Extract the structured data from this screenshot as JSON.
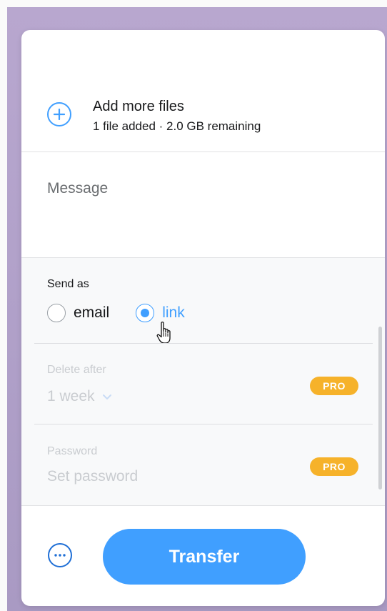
{
  "upload": {
    "add_title": "Add more files",
    "add_subtitle": "1 file added · 2.0 GB remaining"
  },
  "message": {
    "placeholder": "Message"
  },
  "send_as": {
    "label": "Send as",
    "options": [
      {
        "label": "email",
        "selected": false
      },
      {
        "label": "link",
        "selected": true
      }
    ]
  },
  "delete_after": {
    "label": "Delete after",
    "value": "1 week",
    "badge": "PRO"
  },
  "password": {
    "label": "Password",
    "placeholder": "Set password",
    "badge": "PRO"
  },
  "actions": {
    "transfer_label": "Transfer"
  },
  "colors": {
    "accent": "#409fff",
    "pro_badge": "#f6b22a",
    "background": "#b3a2cb"
  },
  "icons": {
    "add": "plus-circle-icon",
    "more": "ellipsis-circle-icon",
    "dropdown": "chevron-down-icon",
    "cursor": "hand-pointer-icon"
  }
}
